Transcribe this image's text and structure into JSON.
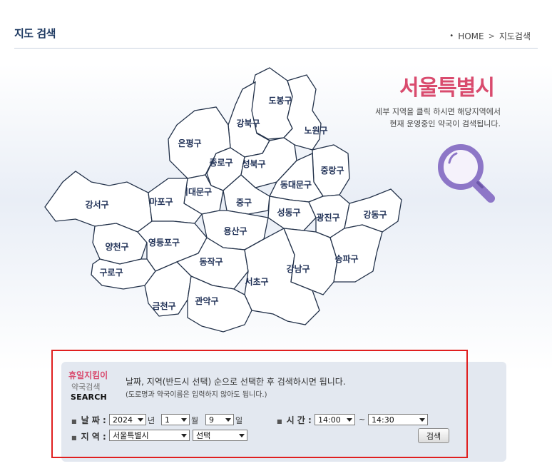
{
  "header": {
    "title": "지도 검색",
    "breadcrumb": [
      "HOME",
      "지도검색"
    ]
  },
  "map": {
    "city_title": "서울특별시",
    "description_line1": "세부 지역을 클릭 하시면 해당지역에서",
    "description_line2": "현재 운영중인 약국이 검색됩니다.",
    "districts": {
      "dobong": "도봉구",
      "gangbuk": "강북구",
      "nowon": "노원구",
      "eunpyeong": "은평구",
      "jongno": "종로구",
      "seongbuk": "성북구",
      "jungnang": "중랑구",
      "dongdaemun": "동대문구",
      "seodaemun": "서대문구",
      "gangseo": "강서구",
      "mapo": "마포구",
      "junggu": "중구",
      "seongdong": "성동구",
      "gwangjin": "광진구",
      "gangdong": "강동구",
      "yongsan": "용산구",
      "yangcheon": "양천구",
      "yeongdeungpo": "영등포구",
      "guro": "구로구",
      "dongjak": "동작구",
      "seocho": "서초구",
      "gangnam": "강남구",
      "songpa": "송파구",
      "geumcheon": "금천구",
      "gwanak": "관악구"
    },
    "accent_color": "#d94b6e"
  },
  "search": {
    "logo_line1": "휴일지킴이",
    "logo_line2": "약국검색",
    "logo_line3": "SEARCH",
    "instruction": "날짜, 지역(반드시 선택) 순으로 선택한 후 검색하시면 됩니다.",
    "instruction_sub": "(도로명과 약국이름은 입력하지 않아도 됩니다.)",
    "date_label": "날 짜 :",
    "year": "2024",
    "year_unit": "년",
    "month": "1",
    "month_unit": "월",
    "day": "9",
    "day_unit": "일",
    "time_label": "시 간 :",
    "time_from": "14:00",
    "time_sep": "~",
    "time_to": "14:30",
    "region_label": "지 역 :",
    "region": "서울특별시",
    "subregion": "선택",
    "search_button": "검색"
  }
}
